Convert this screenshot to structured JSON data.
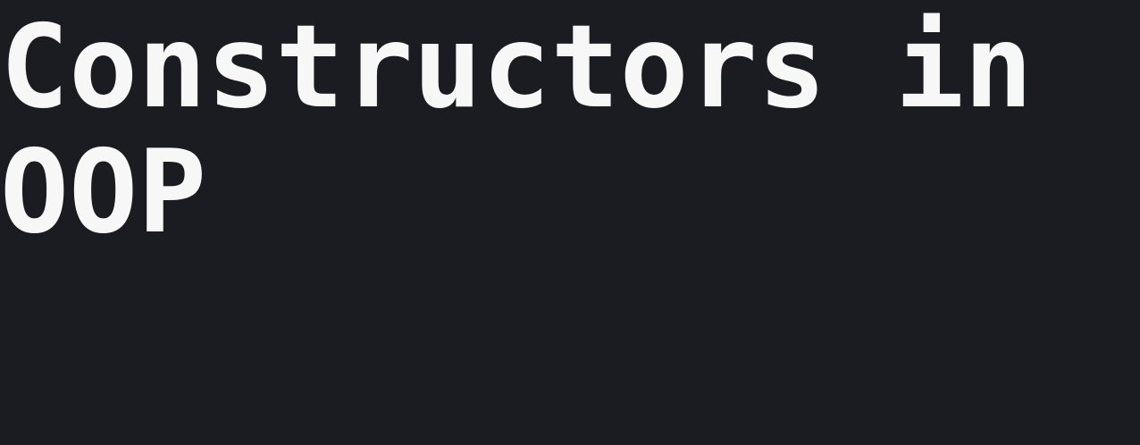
{
  "title": "Constructors in OOP",
  "colors": {
    "background": "#1b1c21",
    "text": "#f7f7f8"
  }
}
